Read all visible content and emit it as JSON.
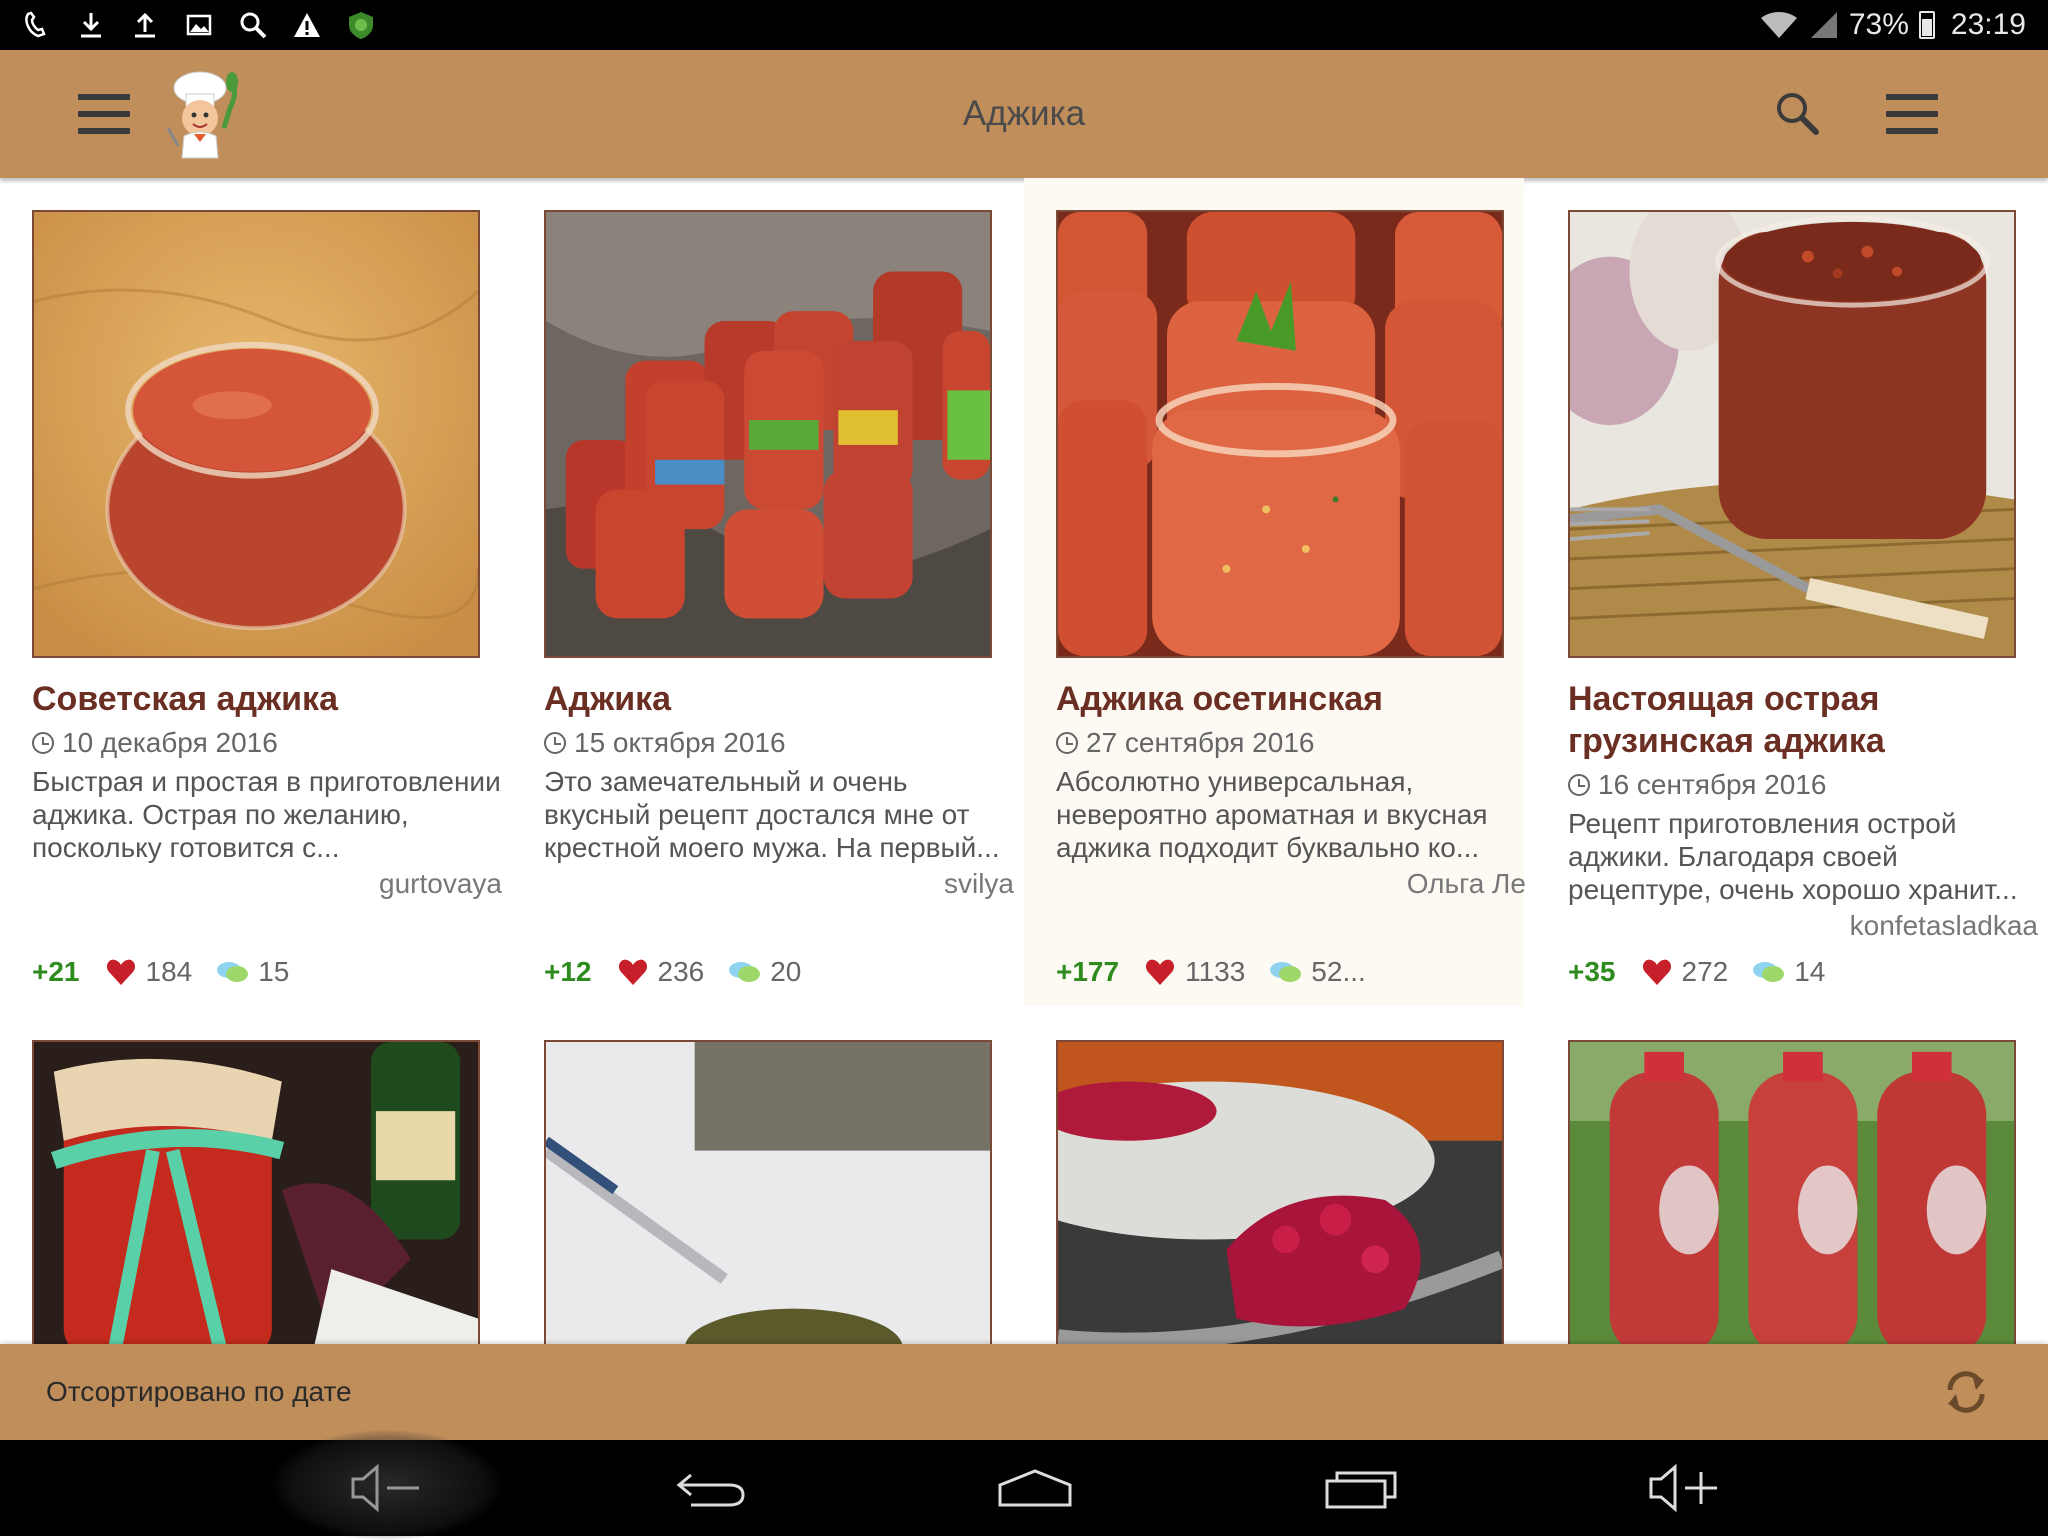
{
  "status_bar": {
    "battery": "73%",
    "time": "23:19",
    "icons": [
      "viber-icon",
      "download-icon",
      "upload-icon",
      "image-icon",
      "search-icon",
      "warning-icon",
      "shield-icon"
    ]
  },
  "app_bar": {
    "title": "Аджика",
    "colors": {
      "bar": "#c08e5b",
      "title_text": "#4a4a4a"
    }
  },
  "cards": [
    {
      "title": "Советская аджика",
      "date": "10 декабря 2016",
      "description": "Быстрая и простая в приготовлении аджика. Острая по желанию, поскольку готовится с...",
      "author": "gurtovaya",
      "rating": "+21",
      "likes": "184",
      "comments": "15"
    },
    {
      "title": "Аджика",
      "date": "15 октября 2016",
      "description": "Это замечательный и очень вкусный рецепт достался мне от крестной моего мужа. На первый...",
      "author": "svilya",
      "rating": "+12",
      "likes": "236",
      "comments": "20"
    },
    {
      "title": "Аджика осетинская",
      "date": "27 сентября 2016",
      "description": "Абсолютно универсальная, невероятно ароматная и вкусная аджика подходит буквально ко...",
      "author": "Ольга Ле",
      "rating": "+177",
      "likes": "1133",
      "comments": "52..."
    },
    {
      "title": "Настоящая острая грузинская аджика",
      "date": "16 сентября 2016",
      "description": "Рецепт приготовления острой аджики. Благодаря своей рецептуре, очень хорошо хранит...",
      "author": "konfetasladkaa",
      "rating": "+35",
      "likes": "272",
      "comments": "14"
    }
  ],
  "sort_bar": {
    "label": "Отсортировано по дате"
  },
  "colors": {
    "title_text": "#6b2e22",
    "rating_green": "#2e8b1e",
    "heart_red": "#c8202a"
  }
}
